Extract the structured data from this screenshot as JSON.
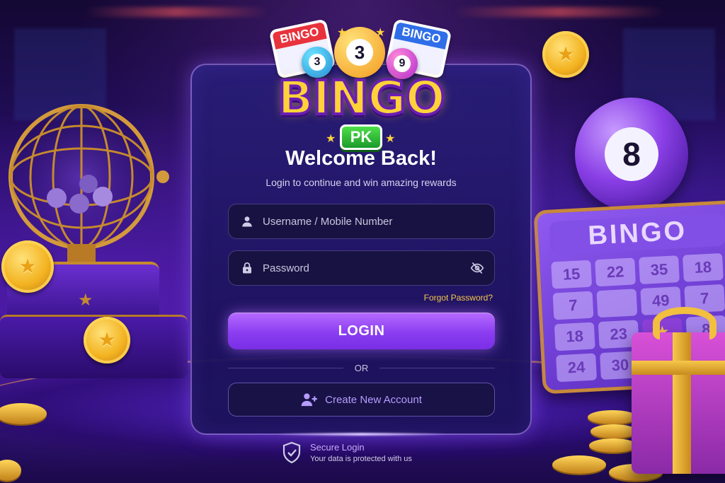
{
  "logo": {
    "tile_left": "BINGO",
    "tile_right": "BINGO",
    "ball_left": "3",
    "ball_center": "3",
    "ball_right": "9",
    "word": "BINGO",
    "badge": "PK"
  },
  "login": {
    "title": "Welcome Back!",
    "subtitle": "Login to continue and win amazing rewards",
    "username_placeholder": "Username / Mobile Number",
    "password_placeholder": "Password",
    "forgot_label": "Forgot Password?",
    "login_label": "LOGIN",
    "divider_label": "OR",
    "create_label": "Create New Account"
  },
  "secure": {
    "title": "Secure Login",
    "subtitle": "Your data is protected with us"
  },
  "decor": {
    "ball_number": "8",
    "card_header": "BINGO",
    "card_cells": [
      "15",
      "22",
      "35",
      "18",
      "7",
      "",
      "49",
      "7",
      "18",
      "23",
      "",
      "8",
      "24",
      "30",
      "",
      ""
    ],
    "icons": [
      "user-icon",
      "lock-icon",
      "eye-off-icon",
      "add-user-icon",
      "shield-check-icon",
      "star-icon"
    ],
    "colors": {
      "accent": "#8a3df0",
      "gold": "#f5c94a",
      "panel": "#1e1460",
      "link": "#b79bff"
    }
  }
}
